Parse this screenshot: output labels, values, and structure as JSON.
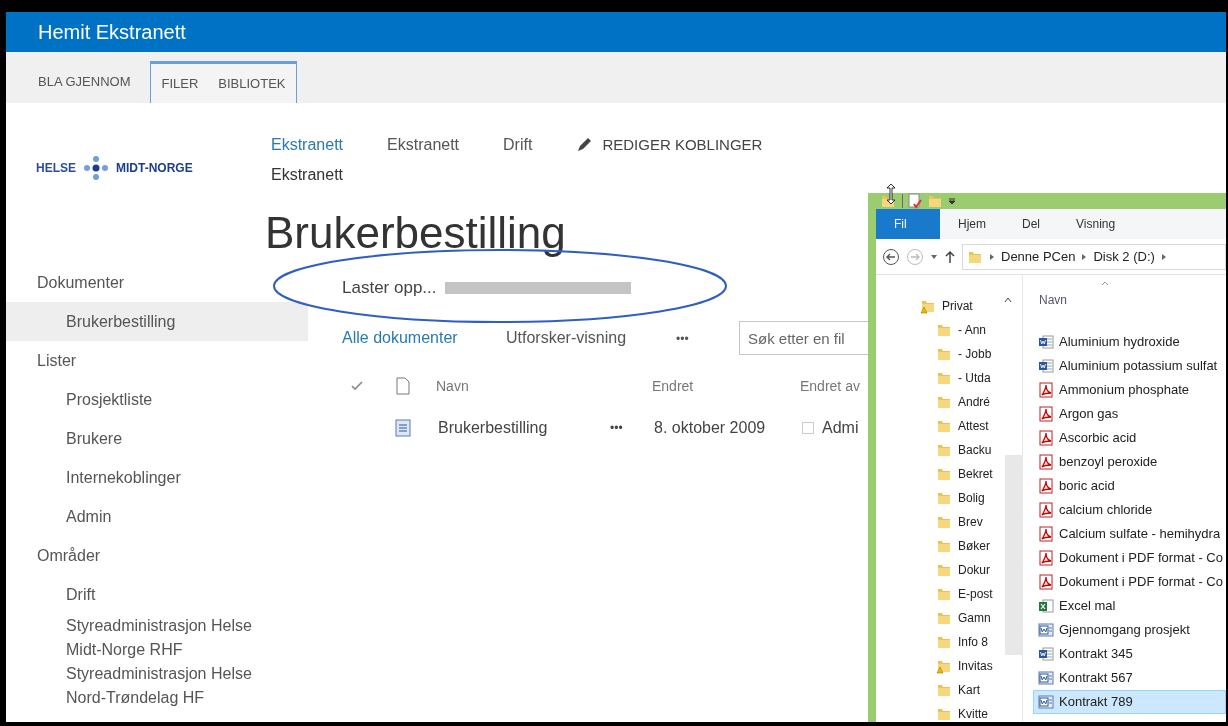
{
  "header": {
    "title": "Hemit Ekstranett"
  },
  "ribbon_tabs": [
    {
      "label": "BLA GJENNOM",
      "contextual": false
    },
    {
      "label": "FILER",
      "contextual": true
    },
    {
      "label": "BIBLIOTEK",
      "contextual": true
    }
  ],
  "logo": {
    "left": "HELSE",
    "right": "MIDT-NORGE"
  },
  "top_nav": [
    {
      "label": "Ekstranett",
      "selected": true
    },
    {
      "label": "Ekstranett",
      "selected": false
    },
    {
      "label": "Drift",
      "selected": false
    }
  ],
  "edit_links": "REDIGER KOBLINGER",
  "top_nav_second_row": "Ekstranett",
  "page_title": "Brukerbestilling",
  "left_nav": [
    {
      "label": "Dokumenter",
      "selected": false,
      "children": [
        {
          "label": "Brukerbestilling",
          "selected": true
        }
      ]
    },
    {
      "label": "Lister",
      "selected": false,
      "children": [
        {
          "label": "Prosjektliste",
          "selected": false
        },
        {
          "label": "Brukere",
          "selected": false
        },
        {
          "label": "Internekoblinger",
          "selected": false
        },
        {
          "label": "Admin",
          "selected": false
        }
      ]
    },
    {
      "label": "Områder",
      "selected": false,
      "children": [
        {
          "label": "Drift",
          "selected": false
        },
        {
          "label": "Styreadministrasjon Helse Midt-Norge RHF",
          "selected": false
        },
        {
          "label": "Styreadministrasjon Helse Nord-Trøndelag HF",
          "selected": false
        }
      ]
    }
  ],
  "upload": {
    "label": "Laster opp...",
    "indeterminate": true
  },
  "views": [
    {
      "label": "Alle dokumenter",
      "selected": true
    },
    {
      "label": "Utforsker-visning",
      "selected": false
    }
  ],
  "more": "•••",
  "search": {
    "placeholder": "Søk etter en fil"
  },
  "table": {
    "columns": [
      "Navn",
      "Endret",
      "Endret av"
    ],
    "rows": [
      {
        "name": "Brukerbestilling",
        "more": "•••",
        "modified": "8. oktober 2009",
        "checked": false,
        "modified_by": "Admi"
      }
    ]
  },
  "explorer": {
    "ribbon_tabs": [
      {
        "label": "Fil",
        "selected": true
      },
      {
        "label": "Hjem",
        "selected": false
      },
      {
        "label": "Del",
        "selected": false
      },
      {
        "label": "Visning",
        "selected": false
      }
    ],
    "path": [
      "Denne PCen",
      "Disk 2 (D:)"
    ],
    "nav": [
      {
        "label": "Privat",
        "kind": "shared"
      },
      {
        "label": "- Ann",
        "kind": "folder"
      },
      {
        "label": "- Jobb",
        "kind": "folder"
      },
      {
        "label": "- Utda",
        "kind": "folder"
      },
      {
        "label": "André",
        "kind": "folder"
      },
      {
        "label": "Attest",
        "kind": "folder"
      },
      {
        "label": "Backu",
        "kind": "folder"
      },
      {
        "label": "Bekret",
        "kind": "folder"
      },
      {
        "label": "Bolig",
        "kind": "folder"
      },
      {
        "label": "Brev",
        "kind": "folder"
      },
      {
        "label": "Bøker",
        "kind": "folder"
      },
      {
        "label": "Dokur",
        "kind": "folder"
      },
      {
        "label": "E-post",
        "kind": "folder"
      },
      {
        "label": "Gamn",
        "kind": "folder"
      },
      {
        "label": "Info 8",
        "kind": "folder"
      },
      {
        "label": "Invitas",
        "kind": "shared"
      },
      {
        "label": "Kart",
        "kind": "folder"
      },
      {
        "label": "Kvitte",
        "kind": "folder"
      }
    ],
    "column": "Navn",
    "files": [
      {
        "name": "Aluminium hydroxide",
        "kind": "word",
        "selected": false
      },
      {
        "name": "Aluminium potassium sulfat",
        "kind": "word",
        "selected": false
      },
      {
        "name": "Ammonium phosphate",
        "kind": "pdf",
        "selected": false
      },
      {
        "name": "Argon gas",
        "kind": "pdf",
        "selected": false
      },
      {
        "name": "Ascorbic acid",
        "kind": "pdf",
        "selected": false
      },
      {
        "name": "benzoyl peroxide",
        "kind": "pdf",
        "selected": false
      },
      {
        "name": "boric acid",
        "kind": "pdf",
        "selected": false
      },
      {
        "name": "calcium chloride",
        "kind": "pdf",
        "selected": false
      },
      {
        "name": "Calcium sulfate - hemihydra",
        "kind": "pdf",
        "selected": false
      },
      {
        "name": "Dokument i PDF format - Co",
        "kind": "pdf",
        "selected": false
      },
      {
        "name": "Dokument i PDF format - Co",
        "kind": "pdf",
        "selected": false
      },
      {
        "name": "Excel mal",
        "kind": "excel",
        "selected": false
      },
      {
        "name": "Gjennomgang prosjekt",
        "kind": "word-old",
        "selected": false
      },
      {
        "name": "Kontrakt 345",
        "kind": "word",
        "selected": false
      },
      {
        "name": "Kontrakt 567",
        "kind": "word-old",
        "selected": false
      },
      {
        "name": "Kontrakt 789",
        "kind": "word-old",
        "selected": true
      }
    ]
  }
}
